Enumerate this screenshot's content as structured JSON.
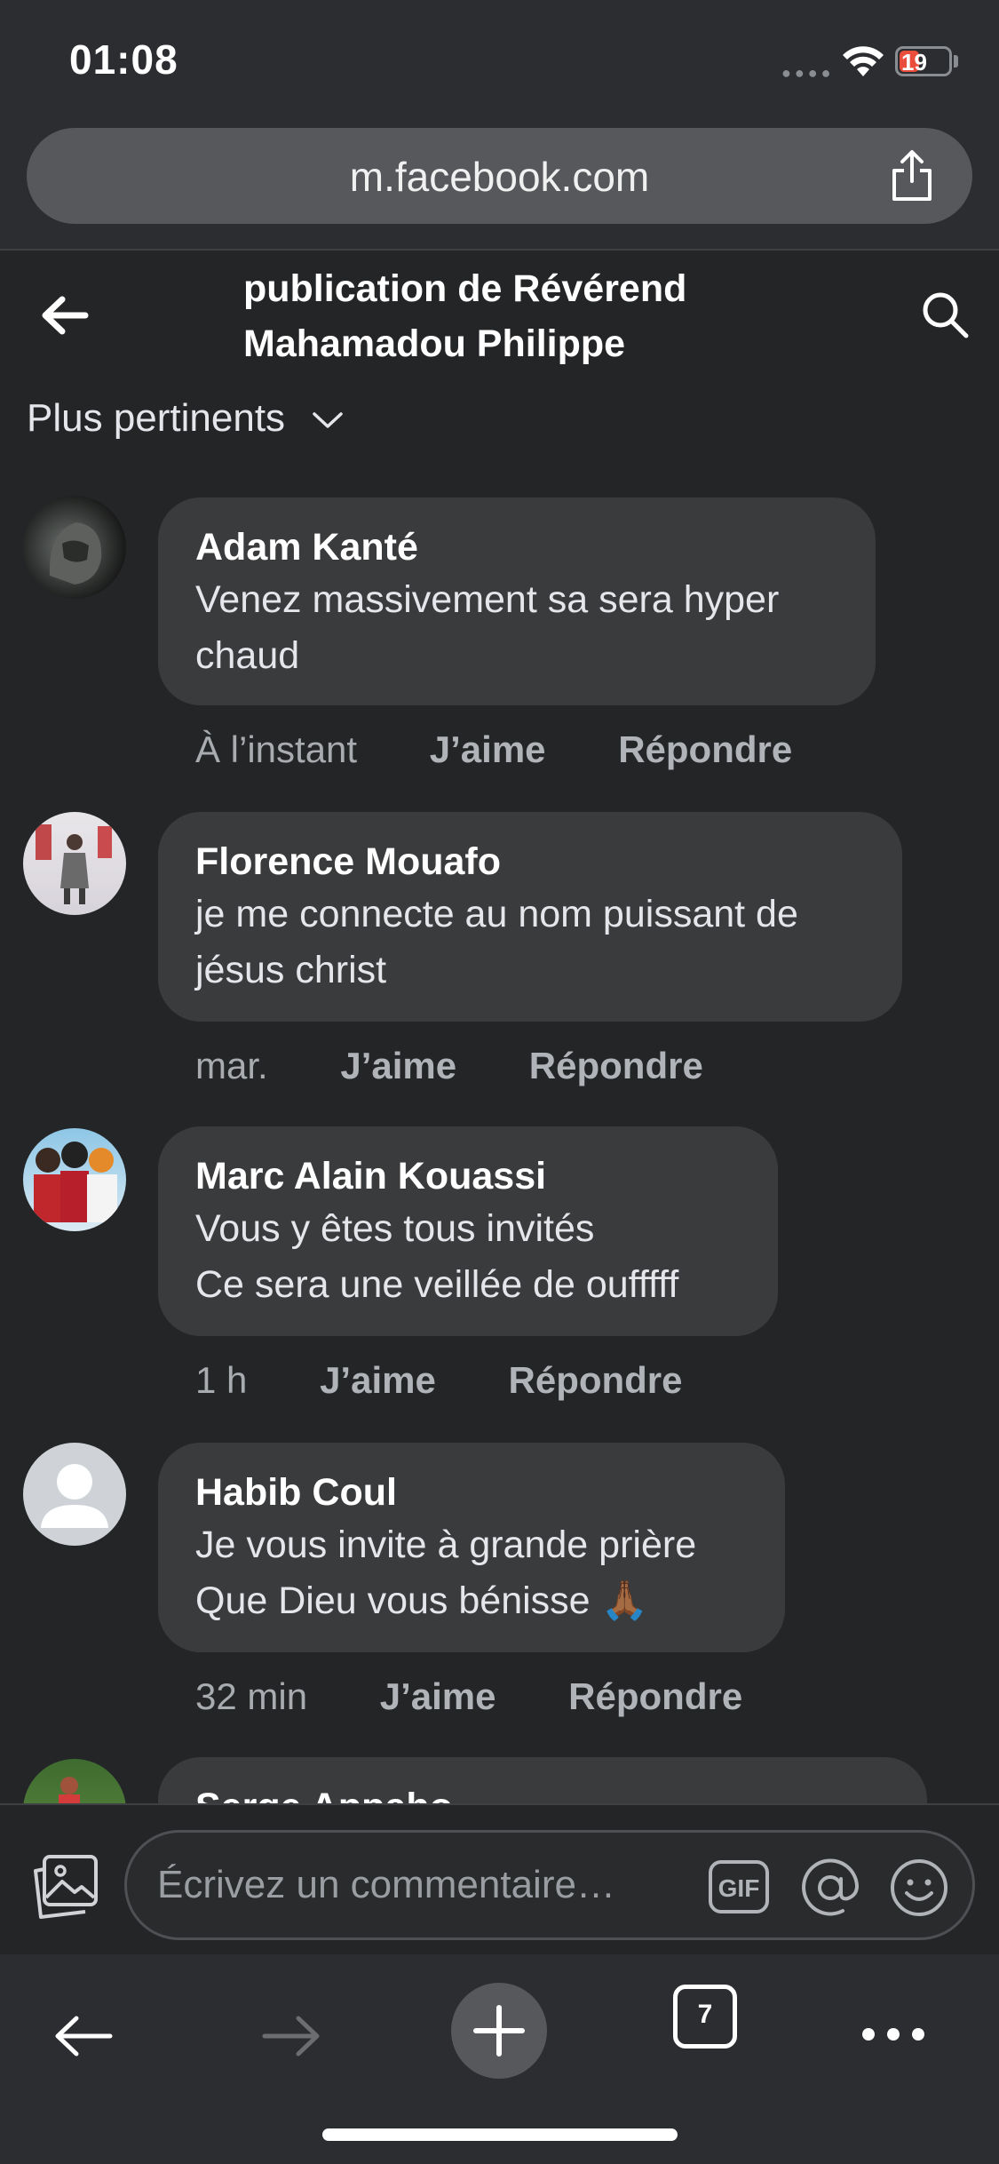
{
  "status_bar": {
    "time": "01:08",
    "battery": "19"
  },
  "browser": {
    "url": "m.facebook.com",
    "tabs_count": "7"
  },
  "header": {
    "title": "publication de Révérend Mahamadou Philippe"
  },
  "sort": {
    "label": "Plus pertinents"
  },
  "comments": [
    {
      "author": "Adam Kanté",
      "text": "Venez massivement sa sera hyper\nchaud",
      "time": "À l’instant",
      "like": "J’aime",
      "reply": "Répondre"
    },
    {
      "author": "Florence Mouafo",
      "text": "je me connecte au nom puissant de\njésus christ",
      "time": "mar.",
      "like": "J’aime",
      "reply": "Répondre"
    },
    {
      "author": "Marc Alain Kouassi",
      "text": "Vous y êtes tous invités\nCe sera une veillée de oufffff",
      "time": "1 h",
      "like": "J’aime",
      "reply": "Répondre"
    },
    {
      "author": "Habib Coul",
      "text": "Je vous invite à grande prière\nQue Dieu vous bénisse 🙏🏾",
      "time": "32 min",
      "like": "J’aime",
      "reply": "Répondre"
    },
    {
      "author": "Serge Appaho"
    }
  ],
  "composer": {
    "placeholder": "Écrivez un commentaire…",
    "gif_label": "GIF"
  },
  "colors": {
    "background": "#242527",
    "bubble": "#3a3b3c",
    "chrome": "#2c2d30",
    "battery_low": "#eb4d3d"
  }
}
